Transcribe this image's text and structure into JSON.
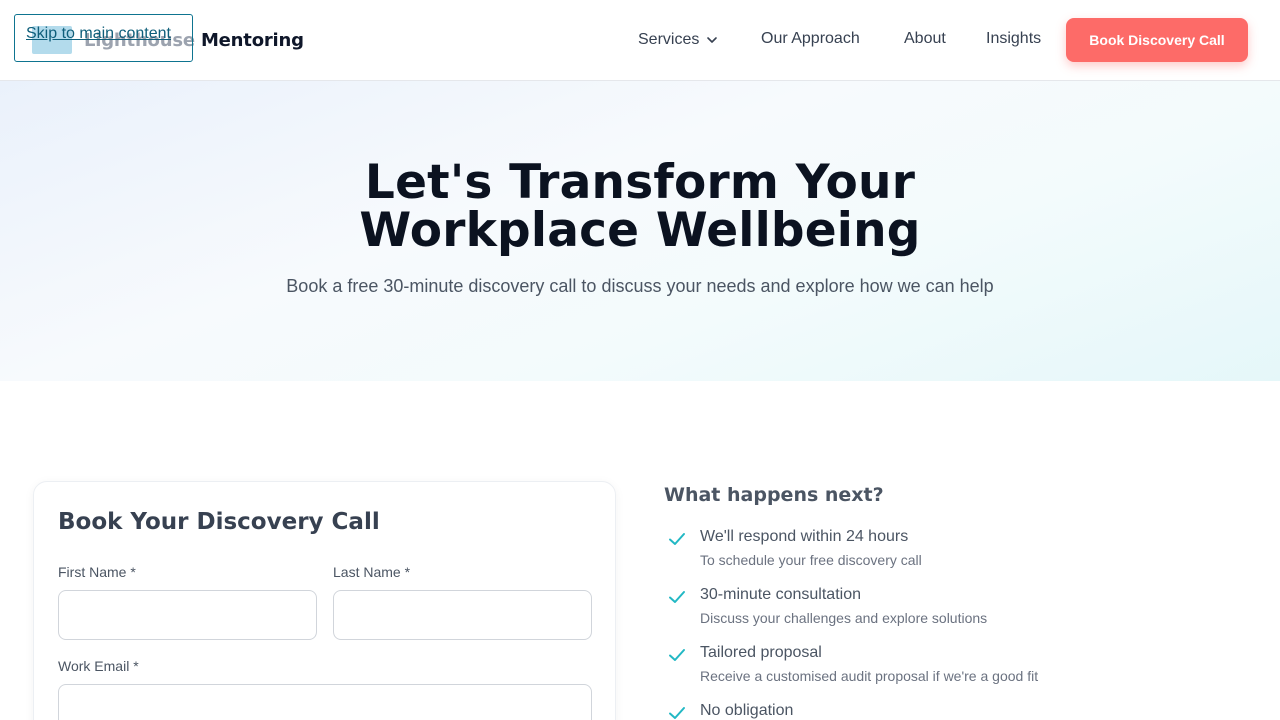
{
  "header": {
    "brand_faded": "Lighthouse",
    "brand_strong": "Mentoring",
    "skip_link": "Skip to main content",
    "nav": {
      "services": "Services",
      "approach": "Our Approach",
      "about": "About",
      "insights": "Insights"
    },
    "cta": "Book Discovery Call",
    "cta_color": "#fd6b68"
  },
  "hero": {
    "title_line1": "Let's Transform Your",
    "title_line2": "Workplace Wellbeing",
    "subtitle": "Book a free 30-minute discovery call to discuss your needs and explore how we can help"
  },
  "form": {
    "title": "Book Your Discovery Call",
    "first_name_label": "First Name *",
    "first_name_value": "",
    "last_name_label": "Last Name *",
    "last_name_value": "",
    "email_label": "Work Email *",
    "email_value": ""
  },
  "next_steps": {
    "title": "What happens next?",
    "check_color": "#22b8c4",
    "items": [
      {
        "title": "We'll respond within 24 hours",
        "desc": "To schedule your free discovery call"
      },
      {
        "title": "30-minute consultation",
        "desc": "Discuss your challenges and explore solutions"
      },
      {
        "title": "Tailored proposal",
        "desc": "Receive a customised audit proposal if we're a good fit"
      },
      {
        "title": "No obligation",
        "desc": ""
      }
    ]
  }
}
